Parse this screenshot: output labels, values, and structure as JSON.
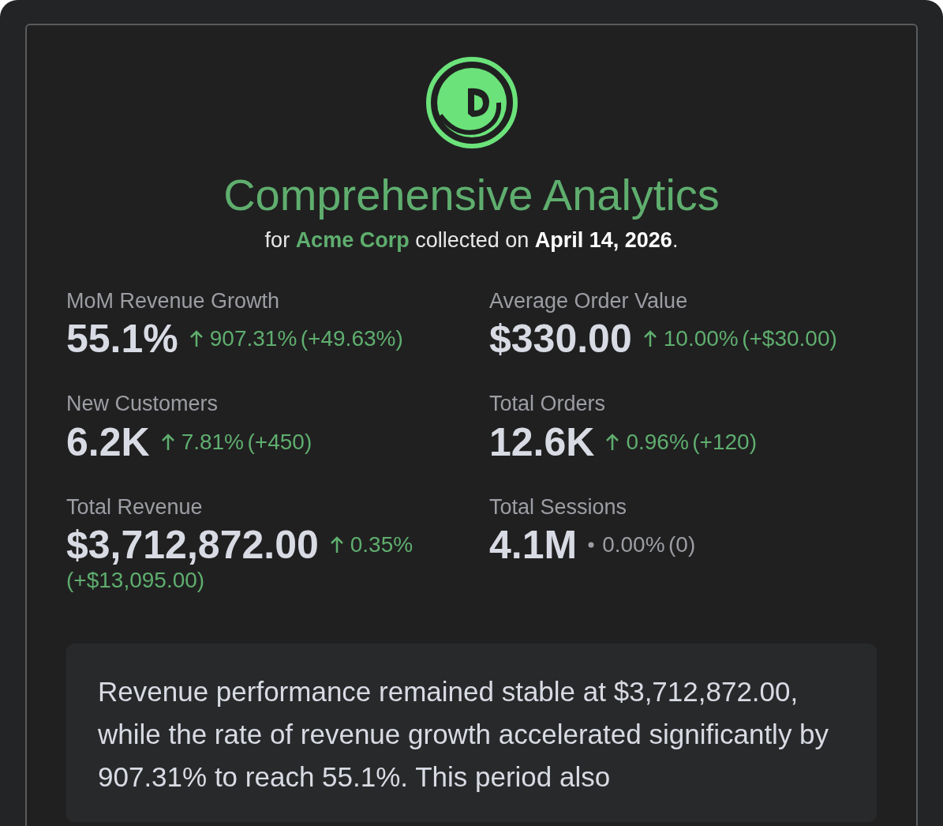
{
  "title": "Comprehensive Analytics",
  "subtitle": [
    {
      "text": "for ",
      "kind": "plain"
    },
    {
      "text": "Acme Corp",
      "kind": "accent"
    },
    {
      "text": " collected on ",
      "kind": "plain"
    },
    {
      "text": "April 14, 2026",
      "kind": "strong"
    },
    {
      "text": ".",
      "kind": "plain"
    }
  ],
  "metrics": [
    {
      "label": "MoM Revenue Growth",
      "value": "55.1%",
      "kind": "up",
      "percent": "907.31%",
      "delta": "(+49.63%)"
    },
    {
      "label": "Average Order Value",
      "value": "$330.00",
      "kind": "up",
      "percent": "10.00%",
      "delta": "(+$30.00)"
    },
    {
      "label": "New Customers",
      "value": "6.2K",
      "kind": "up",
      "percent": "7.81%",
      "delta": "(+450)"
    },
    {
      "label": "Total Orders",
      "value": "12.6K",
      "kind": "up",
      "percent": "0.96%",
      "delta": "(+120)"
    },
    {
      "label": "Total Revenue",
      "value": "$3,712,872.00",
      "kind": "up",
      "percent": "0.35%",
      "delta": "(+$13,095.00)"
    },
    {
      "label": "Total Sessions",
      "value": "4.1M",
      "kind": "flat",
      "percent": "0.00%",
      "delta": "(0)"
    }
  ],
  "summary": "Revenue performance remained stable at $3,712,872.00, while the rate of revenue growth accelerated significantly by 907.31% to reach 55.1%. This period also"
}
